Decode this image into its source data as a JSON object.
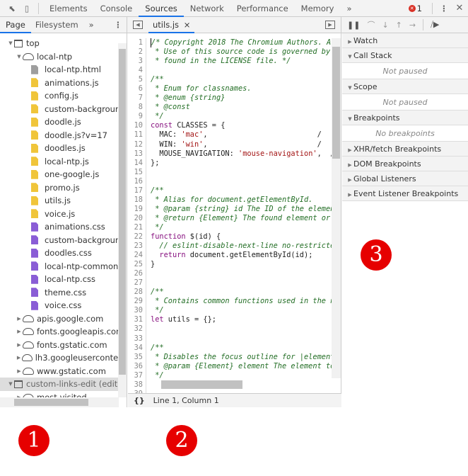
{
  "toolbar": {
    "tabs": [
      "Elements",
      "Console",
      "Sources",
      "Network",
      "Performance",
      "Memory"
    ],
    "active": "Sources",
    "more": "»",
    "error_count": "1",
    "menu": "⋮",
    "close": "✕"
  },
  "navigator": {
    "tabs": [
      "Page",
      "Filesystem"
    ],
    "more": "»",
    "menu": "⋮",
    "tree": [
      {
        "label": "top",
        "type": "frame",
        "depth": 0,
        "open": true
      },
      {
        "label": "local-ntp",
        "type": "domain",
        "depth": 1,
        "open": true
      },
      {
        "label": "local-ntp.html",
        "type": "html",
        "depth": 2
      },
      {
        "label": "animations.js",
        "type": "js",
        "depth": 2
      },
      {
        "label": "config.js",
        "type": "js",
        "depth": 2
      },
      {
        "label": "custom-background",
        "type": "js",
        "depth": 2
      },
      {
        "label": "doodle.js",
        "type": "js",
        "depth": 2
      },
      {
        "label": "doodle.js?v=17",
        "type": "js",
        "depth": 2
      },
      {
        "label": "doodles.js",
        "type": "js",
        "depth": 2
      },
      {
        "label": "local-ntp.js",
        "type": "js",
        "depth": 2
      },
      {
        "label": "one-google.js",
        "type": "js",
        "depth": 2
      },
      {
        "label": "promo.js",
        "type": "js",
        "depth": 2
      },
      {
        "label": "utils.js",
        "type": "js",
        "depth": 2
      },
      {
        "label": "voice.js",
        "type": "js",
        "depth": 2
      },
      {
        "label": "animations.css",
        "type": "css",
        "depth": 2
      },
      {
        "label": "custom-background",
        "type": "css",
        "depth": 2
      },
      {
        "label": "doodles.css",
        "type": "css",
        "depth": 2
      },
      {
        "label": "local-ntp-common.c",
        "type": "css",
        "depth": 2
      },
      {
        "label": "local-ntp.css",
        "type": "css",
        "depth": 2
      },
      {
        "label": "theme.css",
        "type": "css",
        "depth": 2
      },
      {
        "label": "voice.css",
        "type": "css",
        "depth": 2
      },
      {
        "label": "apis.google.com",
        "type": "domain",
        "depth": 1,
        "open": false
      },
      {
        "label": "fonts.googleapis.com",
        "type": "domain",
        "depth": 1,
        "open": false
      },
      {
        "label": "fonts.gstatic.com",
        "type": "domain",
        "depth": 1,
        "open": false
      },
      {
        "label": "lh3.googleusercontent",
        "type": "domain",
        "depth": 1,
        "open": false
      },
      {
        "label": "www.gstatic.com",
        "type": "domain",
        "depth": 1,
        "open": false
      },
      {
        "label": "custom-links-edit (edit",
        "type": "frame",
        "depth": 0,
        "open": true,
        "selected": true
      },
      {
        "label": "most-visited",
        "type": "domain",
        "depth": 1,
        "open": false
      }
    ]
  },
  "editor": {
    "tab": "utils.js",
    "tab_close": "×",
    "status": "Line 1, Column 1",
    "format_icon": "{}",
    "lines": [
      [
        [
          "c",
          "/* Copyright 2018 The Chromium Authors. Al"
        ]
      ],
      [
        [
          "c",
          " * Use of this source code is governed by"
        ]
      ],
      [
        [
          "c",
          " * found in the LICENSE file. */"
        ]
      ],
      [],
      [
        [
          "c",
          "/**"
        ]
      ],
      [
        [
          "c",
          " * Enum for classnames."
        ]
      ],
      [
        [
          "c",
          " * @enum {string}"
        ]
      ],
      [
        [
          "c",
          " * @const"
        ]
      ],
      [
        [
          "c",
          " */"
        ]
      ],
      [
        [
          "k",
          "const"
        ],
        [
          "p",
          " CLASSES = {"
        ]
      ],
      [
        [
          "p",
          "  MAC: "
        ],
        [
          "s",
          "'mac'"
        ],
        [
          "p",
          ",                         /"
        ]
      ],
      [
        [
          "p",
          "  WIN: "
        ],
        [
          "s",
          "'win'"
        ],
        [
          "p",
          ",                         /"
        ]
      ],
      [
        [
          "p",
          "  MOUSE_NAVIGATION: "
        ],
        [
          "s",
          "'mouse-navigation'"
        ],
        [
          "p",
          ",  /"
        ]
      ],
      [
        [
          "p",
          "};"
        ]
      ],
      [],
      [],
      [
        [
          "c",
          "/**"
        ]
      ],
      [
        [
          "c",
          " * Alias for document.getElementById."
        ]
      ],
      [
        [
          "c",
          " * @param {string} id The ID of the elemen"
        ]
      ],
      [
        [
          "c",
          " * @return {Element} The found element or"
        ]
      ],
      [
        [
          "c",
          " */"
        ]
      ],
      [
        [
          "k",
          "function"
        ],
        [
          "p",
          " $(id) {"
        ]
      ],
      [
        [
          "c",
          "  // eslint-disable-next-line no-restricte"
        ]
      ],
      [
        [
          "k",
          "  return"
        ],
        [
          "p",
          " document.getElementById(id);"
        ]
      ],
      [
        [
          "p",
          "}"
        ]
      ],
      [],
      [],
      [
        [
          "c",
          "/**"
        ]
      ],
      [
        [
          "c",
          " * Contains common functions used in the n"
        ]
      ],
      [
        [
          "c",
          " */"
        ]
      ],
      [
        [
          "k",
          "let"
        ],
        [
          "p",
          " utils = {};"
        ]
      ],
      [],
      [],
      [
        [
          "c",
          "/**"
        ]
      ],
      [
        [
          "c",
          " * Disables the focus outline for |element"
        ]
      ],
      [
        [
          "c",
          " * @param {Element} element The element to"
        ]
      ],
      [
        [
          "c",
          " */"
        ]
      ],
      [
        [
          "p",
          "utils.disableOutlineOnMouseClick = functi"
        ]
      ],
      []
    ]
  },
  "debugger": {
    "sections": [
      {
        "title": "Watch",
        "open": false
      },
      {
        "title": "Call Stack",
        "open": true,
        "body": "Not paused"
      },
      {
        "title": "Scope",
        "open": true,
        "body": "Not paused"
      },
      {
        "title": "Breakpoints",
        "open": true,
        "body": "No breakpoints"
      },
      {
        "title": "XHR/fetch Breakpoints",
        "open": false
      },
      {
        "title": "DOM Breakpoints",
        "open": false
      },
      {
        "title": "Global Listeners",
        "open": false
      },
      {
        "title": "Event Listener Breakpoints",
        "open": false
      }
    ]
  },
  "callouts": [
    "1",
    "2",
    "3"
  ],
  "colors": {
    "accent": "#1a73e8",
    "js_file": "#f0c53a",
    "css_file": "#8a5dd6",
    "html_file": "#9e9e9e",
    "callout": "#e60000",
    "error": "#d93025"
  }
}
